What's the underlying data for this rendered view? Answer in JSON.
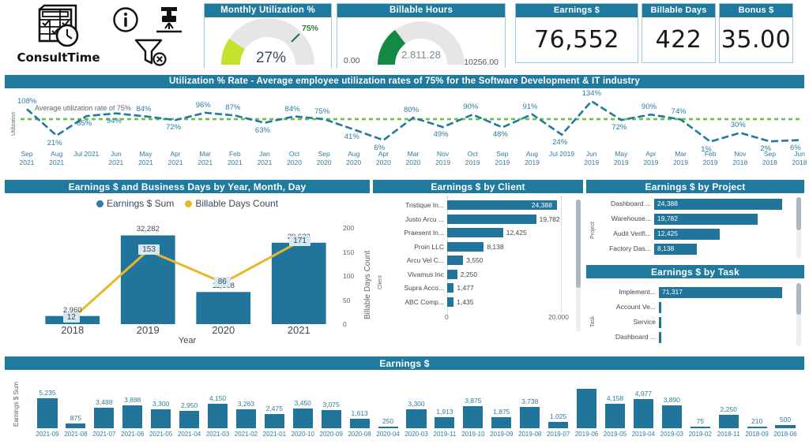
{
  "brand": {
    "name": "ConsultTime",
    "logo_icon": "calendar-clock-icon"
  },
  "toolbar": {
    "info_icon": "info-circle-icon",
    "focus_icon": "drill-down-icon",
    "clear_filter_icon": "clear-filter-icon"
  },
  "kpis": {
    "monthly_utilization": {
      "title": "Monthly Utilization %",
      "value_label": "27%",
      "value": 27,
      "target_label": "75%",
      "target": 75,
      "arc_color": "#c7e22e"
    },
    "billable_hours": {
      "title": "Billable Hours",
      "value_label": "2.811.28",
      "value": 2811.28,
      "min_label": "0.00",
      "max_label": "10256.00",
      "min": 0,
      "max": 10256,
      "arc_color": "#128a43"
    },
    "earnings": {
      "title": "Earnings $",
      "value": "76,552"
    },
    "billable_days": {
      "title": "Billable Days",
      "value": "422"
    },
    "bonus": {
      "title": "Bonus $",
      "value": "35.00"
    }
  },
  "utilization": {
    "title": "Utilization % Rate - Average employee utilization rates of 75% for the Software Development & IT industry",
    "axis_label": "Utilization",
    "average_note": "Average utilization rate of 75%"
  },
  "earnings_days": {
    "title": "Earnings $ and Business Days by Year, Month, Day",
    "legend": [
      {
        "label": "Earnings $ Sum",
        "color": "#2e7ca1"
      },
      {
        "label": "Billable Days Count",
        "color": "#e8b72a"
      }
    ],
    "xlabel": "Year",
    "y2label": "Billable Days Count"
  },
  "by_client": {
    "title": "Earnings $ by Client",
    "axis_label": "Client"
  },
  "by_project": {
    "title": "Earnings $ by Project",
    "axis_label": "Project"
  },
  "by_task": {
    "title": "Earnings $ by Task",
    "axis_label": "Task"
  },
  "earnings_bottom": {
    "title": "Earnings $",
    "ylabel": "Earnings $ Sum"
  },
  "chart_data": [
    {
      "type": "line",
      "name": "utilization-rate",
      "title": "Utilization % Rate - Average employee utilization rates of 75% for the Software Development & IT industry",
      "xlabel": "",
      "ylabel": "Utilization",
      "grid": false,
      "legend": "none",
      "reference_line": {
        "label": "Average utilization rate of 75%",
        "value": 75,
        "color": "#6ebe4a"
      },
      "x": [
        "Sep 2021",
        "Aug 2021",
        "Jul 2021",
        "Jun 2021",
        "May 2021",
        "Apr 2021",
        "Mar 2021",
        "Feb 2021",
        "Jan 2021",
        "Oct 2020",
        "Sep 2020",
        "Aug 2020",
        "Apr 2020",
        "Mar 2020",
        "Nov 2019",
        "Oct 2019",
        "Sep 2019",
        "Aug 2019",
        "Jul 2019",
        "Jun 2019",
        "May 2019",
        "Apr 2019",
        "Mar 2019",
        "Feb 2019",
        "Nov 2018",
        "Sep 2018",
        "Jun 2018"
      ],
      "x_tick_lines": [
        [
          "Sep",
          "2021"
        ],
        [
          "Aug",
          "2021"
        ],
        [
          "Jul 2021",
          ""
        ],
        [
          "Jun",
          "2021"
        ],
        [
          "May",
          "2021"
        ],
        [
          "Apr",
          "2021"
        ],
        [
          "Mar",
          "2021"
        ],
        [
          "Feb",
          "2021"
        ],
        [
          "Jan",
          "2021"
        ],
        [
          "Oct",
          "2020"
        ],
        [
          "Sep",
          "2020"
        ],
        [
          "Aug",
          "2020"
        ],
        [
          "Apr",
          "2020"
        ],
        [
          "Mar",
          "2020"
        ],
        [
          "Nov",
          "2019"
        ],
        [
          "Oct",
          "2019"
        ],
        [
          "Sep",
          "2019"
        ],
        [
          "Aug",
          "2019"
        ],
        [
          "Jul 2019",
          ""
        ],
        [
          "Jun",
          "2019"
        ],
        [
          "May",
          "2019"
        ],
        [
          "Apr",
          "2019"
        ],
        [
          "Mar",
          "2019"
        ],
        [
          "Feb",
          "2019"
        ],
        [
          "Nov",
          "2018"
        ],
        [
          "Sep",
          "2018"
        ],
        [
          "Jun",
          "2018"
        ]
      ],
      "values": [
        108,
        21,
        85,
        94,
        84,
        72,
        96,
        87,
        63,
        84,
        75,
        41,
        6,
        80,
        49,
        90,
        48,
        91,
        24,
        134,
        72,
        90,
        74,
        1,
        30,
        2,
        6
      ],
      "value_labels": [
        "108%",
        "21%",
        "85%",
        "94%",
        "84%",
        "72%",
        "96%",
        "87%",
        "63%",
        "84%",
        "75%",
        "41%",
        "6%",
        "80%",
        "49%",
        "90%",
        "48%",
        "91%",
        "24%",
        "134%",
        "72%",
        "90%",
        "74%",
        "1%",
        "30%",
        "2%",
        "6%"
      ],
      "label_positions": [
        "above",
        "below",
        "below",
        "below",
        "above",
        "below",
        "above",
        "above",
        "below",
        "above",
        "above",
        "below",
        "below",
        "above",
        "below",
        "above",
        "below",
        "above",
        "below",
        "above",
        "below",
        "above",
        "above",
        "below",
        "above",
        "below",
        "below"
      ],
      "series_color": "#1f7a9e",
      "ylim": [
        0,
        140
      ]
    },
    {
      "type": "bar",
      "name": "earnings-and-days-by-year",
      "title": "Earnings $ and Business Days by Year, Month, Day",
      "xlabel": "Year",
      "ylabel": "",
      "y2label": "Billable Days Count",
      "categories": [
        "2018",
        "2019",
        "2020",
        "2021"
      ],
      "series": [
        {
          "name": "Earnings $ Sum",
          "type": "bar",
          "color": "#21759b",
          "values": [
            2960,
            32282,
            11688,
            29622
          ],
          "value_labels": [
            "2,960",
            "32,282",
            "11,688",
            "29,622"
          ]
        },
        {
          "name": "Billable Days Count",
          "type": "line",
          "color": "#e8b72a",
          "axis": "y2",
          "values": [
            12,
            153,
            86,
            171
          ],
          "value_labels": [
            "12",
            "153",
            "86",
            "171"
          ]
        }
      ],
      "y2lim": [
        0,
        200
      ],
      "y2_ticks": [
        "0",
        "50",
        "100",
        "150",
        "200"
      ]
    },
    {
      "type": "bar",
      "orientation": "horizontal",
      "name": "earnings-by-client",
      "title": "Earnings $ by Client",
      "ylabel": "Client",
      "categories": [
        "Tristique In...",
        "Justo Arcu ...",
        "Praesent In...",
        "Proin LLC",
        "Arcu Vel C...",
        "Vivamus Inc",
        "Supra Acco...",
        "ABC Comp..."
      ],
      "values": [
        24388,
        19782,
        12425,
        8138,
        3550,
        2250,
        1477,
        1435
      ],
      "value_labels": [
        "24,388",
        "19,782",
        "12,425",
        "8,138",
        "3,550",
        "2,250",
        "1,477",
        "1,435"
      ],
      "x_ticks": [
        "0",
        "20,000"
      ],
      "xlim": [
        0,
        26000
      ],
      "bar_color": "#21759b"
    },
    {
      "type": "bar",
      "orientation": "horizontal",
      "name": "earnings-by-project",
      "title": "Earnings $ by Project",
      "ylabel": "Project",
      "categories": [
        "Dashboard ...",
        "Warehouse...",
        "Audit Verifi...",
        "Factory Das..."
      ],
      "values": [
        24388,
        19782,
        12425,
        8138
      ],
      "value_labels": [
        "24,388",
        "19,782",
        "12,425",
        "8,138"
      ],
      "xlim": [
        0,
        24388
      ],
      "bar_color": "#21759b"
    },
    {
      "type": "bar",
      "orientation": "horizontal",
      "name": "earnings-by-task",
      "title": "Earnings $ by Task",
      "ylabel": "Task",
      "categories": [
        "Implement...",
        "Account Ve...",
        "Service",
        "Dashboard ..."
      ],
      "values": [
        71317,
        0,
        0,
        0
      ],
      "value_labels": [
        "71,317",
        "",
        "",
        ""
      ],
      "xlim": [
        0,
        71317
      ],
      "bar_color": "#21759b"
    },
    {
      "type": "bar",
      "name": "earnings-by-month",
      "title": "Earnings $",
      "ylabel": "Earnings $ Sum",
      "xlabel": "",
      "categories": [
        "2021-09",
        "2021-08",
        "2021-07",
        "2021-06",
        "2021-05",
        "2021-04",
        "2021-03",
        "2021-02",
        "2021-01",
        "2020-10",
        "2020-09",
        "2020-08",
        "2020-04",
        "2020-03",
        "2019-11",
        "2019-10",
        "2019-09",
        "2019-08",
        "2019-07",
        "2019-06",
        "2019-05",
        "2019-04",
        "2019-03",
        "2019-02",
        "2018-11",
        "2018-09",
        "2018-06"
      ],
      "values": [
        5235,
        875,
        3488,
        3888,
        3300,
        2950,
        4150,
        3263,
        2475,
        3450,
        3075,
        1613,
        250,
        3300,
        1913,
        3875,
        1875,
        3738,
        1025,
        6800,
        4158,
        4977,
        3890,
        75,
        2250,
        210,
        500
      ],
      "value_labels": [
        "5,235",
        "875",
        "3,488",
        "3,888",
        "3,300",
        "2,950",
        "4,150",
        "3,263",
        "2,475",
        "3,450",
        "3,075",
        "1,613",
        "250",
        "3,300",
        "1,913",
        "3,875",
        "1,875",
        "3,738",
        "1,025",
        "",
        "4,158",
        "4,977",
        "3,890",
        "75",
        "2,250",
        "210",
        "500"
      ],
      "bar_color": "#21759b",
      "ylim": [
        0,
        6800
      ]
    }
  ]
}
